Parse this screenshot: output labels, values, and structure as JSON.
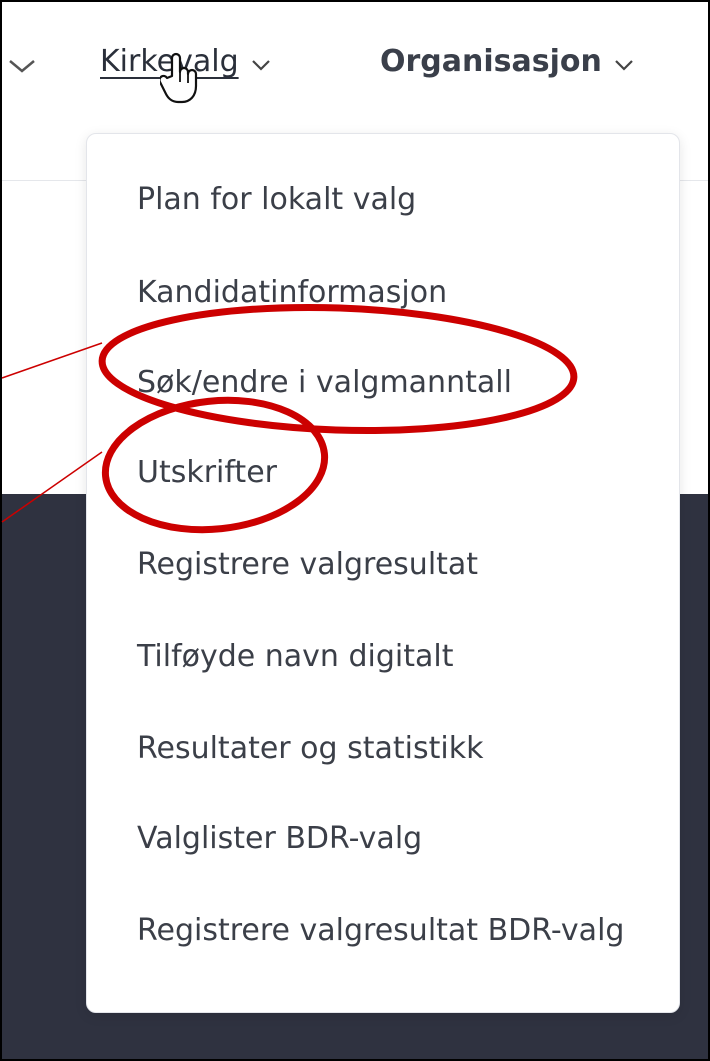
{
  "nav": {
    "kirkevalg_label": "Kirkevalg",
    "organisasjon_label": "Organisasjon"
  },
  "dropdown": {
    "items": [
      {
        "label": "Plan for lokalt valg"
      },
      {
        "label": "Kandidatinformasjon"
      },
      {
        "label": "Søk/endre i valgmanntall"
      },
      {
        "label": "Utskrifter"
      },
      {
        "label": "Registrere valgresultat"
      },
      {
        "label": "Tilføyde navn digitalt"
      },
      {
        "label": "Resultater og statistikk"
      },
      {
        "label": "Valglister BDR-valg"
      },
      {
        "label": "Registrere valgresultat BDR-valg"
      }
    ]
  },
  "annotations": {
    "highlight_color": "#cc0000",
    "highlighted_items": [
      "Søk/endre i valgmanntall",
      "Utskrifter"
    ]
  }
}
